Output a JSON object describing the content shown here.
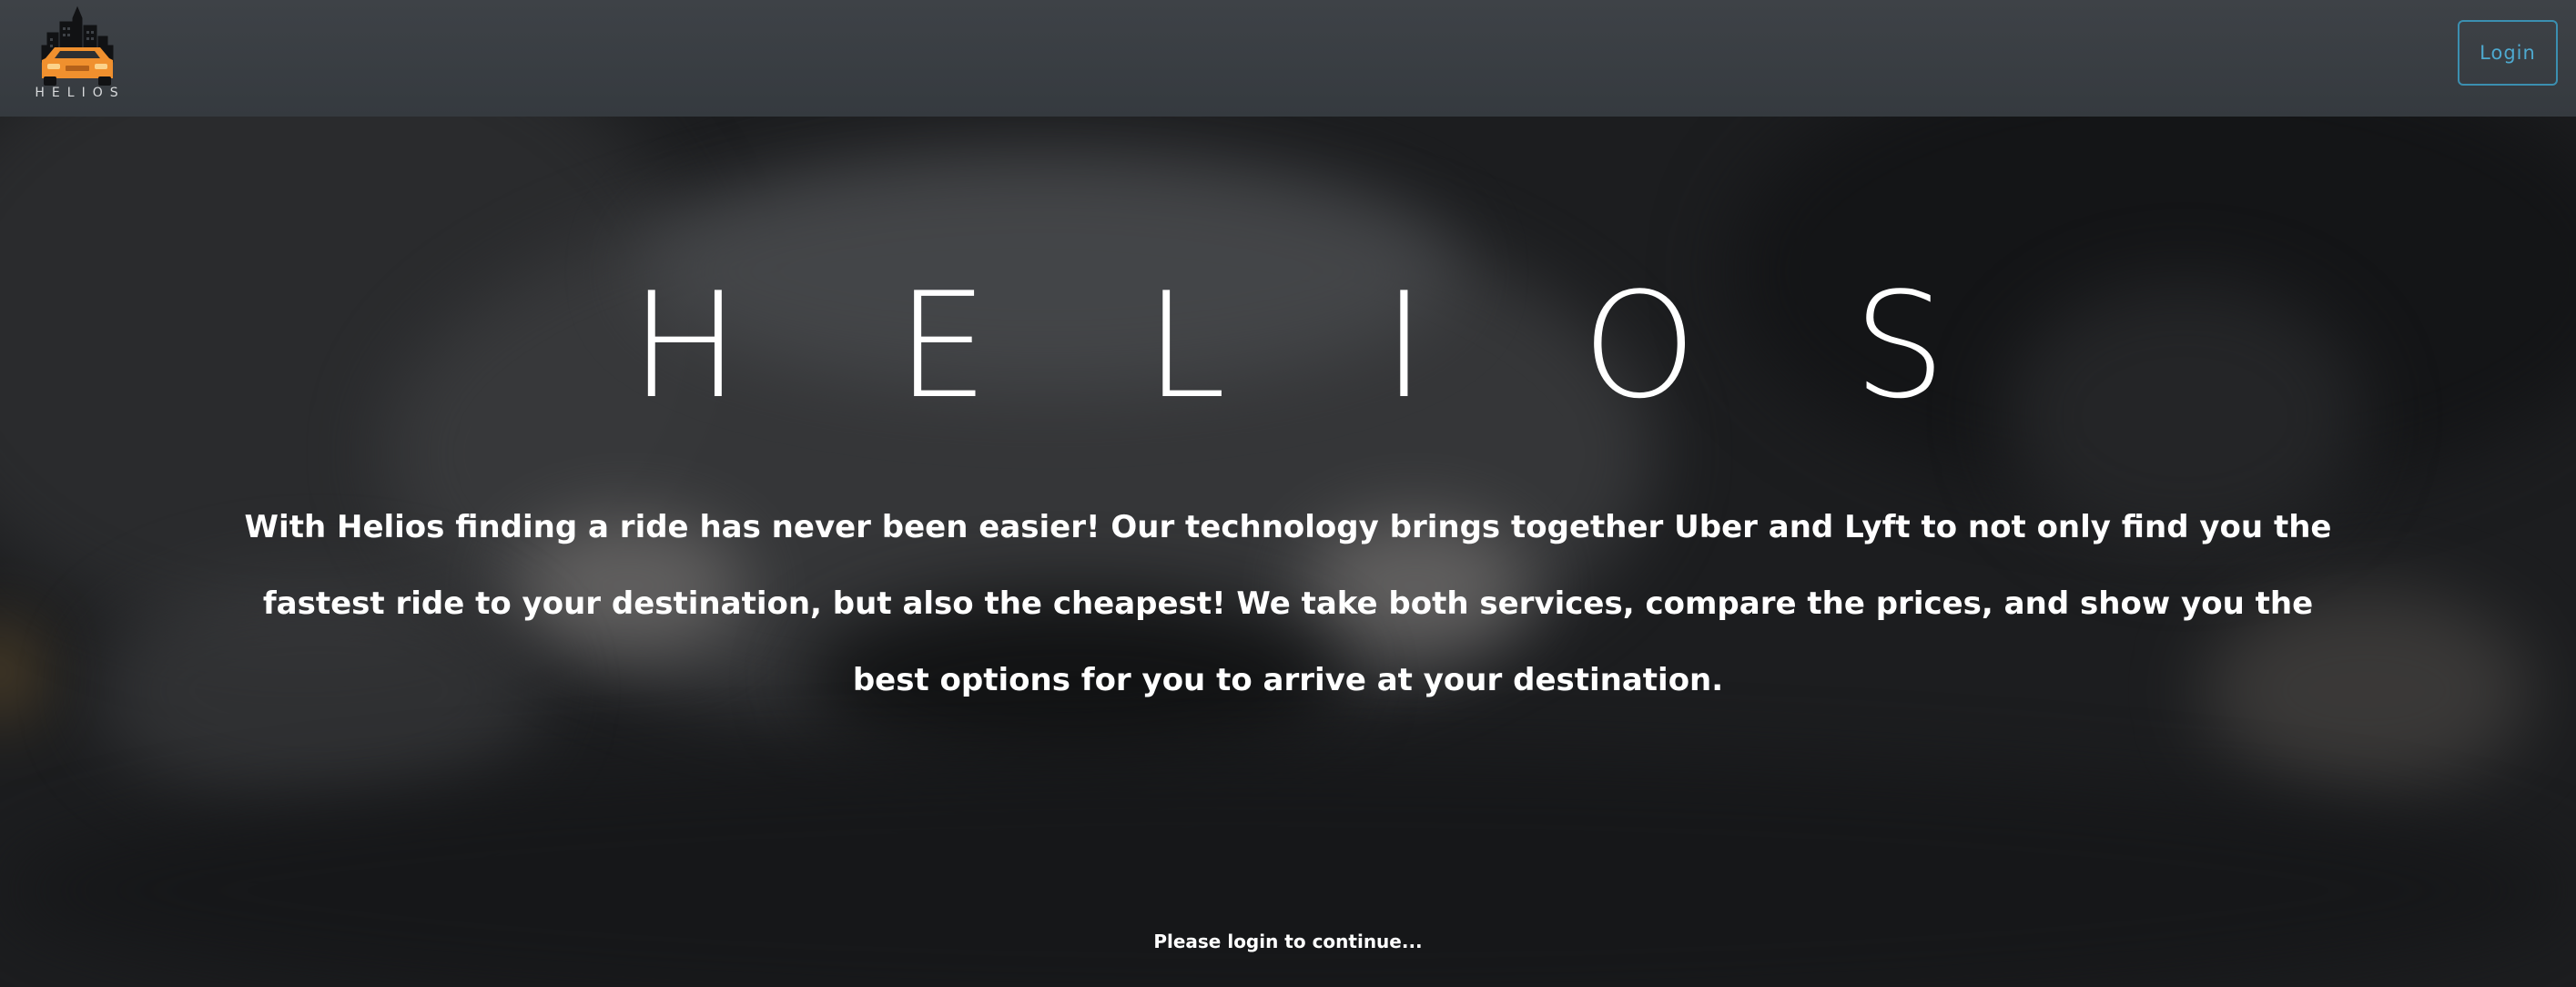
{
  "navbar": {
    "logo_text": "HELIOS",
    "login_label": "Login"
  },
  "hero": {
    "title": "HELIOS",
    "description": "With Helios finding a ride has never been easier! Our technology brings together Uber and Lyft to not only find you the fastest ride to your destination, but also the cheapest! We take both services, compare the prices, and show you the best options for you to arrive at your destination.",
    "note": "Please login to continue..."
  },
  "colors": {
    "navbar_bg": "#3a3f44",
    "accent": "#3b8fb0",
    "logo_car": "#f0902e",
    "text": "#ffffff"
  },
  "icons": {
    "logo": "car-with-city-skyline-icon"
  }
}
